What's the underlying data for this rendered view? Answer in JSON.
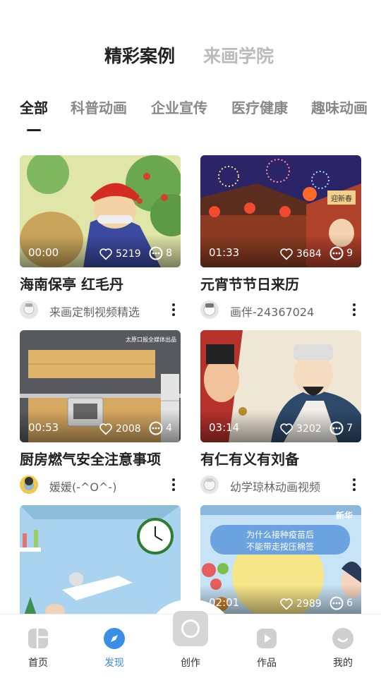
{
  "header": {
    "tabs": [
      {
        "label": "精彩案例"
      },
      {
        "label": "来画学院"
      }
    ]
  },
  "categories": [
    {
      "label": "全部"
    },
    {
      "label": "科普动画"
    },
    {
      "label": "企业宣传"
    },
    {
      "label": "医疗健康"
    },
    {
      "label": "趣味动画"
    }
  ],
  "cards": [
    {
      "title": "海南保亭 红毛丹",
      "duration": "00:00",
      "likes": "5219",
      "comments": "8",
      "author": "来画定制视频精选"
    },
    {
      "title": "元宵节节日来历",
      "duration": "01:33",
      "likes": "3684",
      "comments": "9",
      "author": "画伴-24367024"
    },
    {
      "title": "厨房燃气安全注意事项",
      "duration": "00:53",
      "likes": "2008",
      "comments": "4",
      "author": "媛媛(-^O^-)"
    },
    {
      "title": "有仁有义有刘备",
      "duration": "03:14",
      "likes": "3202",
      "comments": "7",
      "author": "幼学琼林动画视频"
    },
    {
      "title": "",
      "duration": "",
      "likes": "",
      "comments": "",
      "author": ""
    },
    {
      "title": "",
      "duration": "02:01",
      "likes": "2989",
      "comments": "6",
      "author": ""
    }
  ],
  "thumb_text": {
    "card2_sign": "迎新春",
    "card3_caption": "太原口报全媒体出品",
    "card6_banner_line1": "为什么接种疫苗后",
    "card6_banner_line2": "不能带走按压棉签",
    "card6_logo": "新华"
  },
  "tabbar": {
    "items": [
      {
        "label": "首页",
        "icon": "home-icon"
      },
      {
        "label": "发现",
        "icon": "compass-icon"
      },
      {
        "label": "创作",
        "icon": "create-icon"
      },
      {
        "label": "作品",
        "icon": "video-icon"
      },
      {
        "label": "我的",
        "icon": "profile-icon"
      }
    ]
  },
  "colors": {
    "accent": "#3a8ee6",
    "text_primary": "#222222",
    "text_secondary": "#888888"
  }
}
